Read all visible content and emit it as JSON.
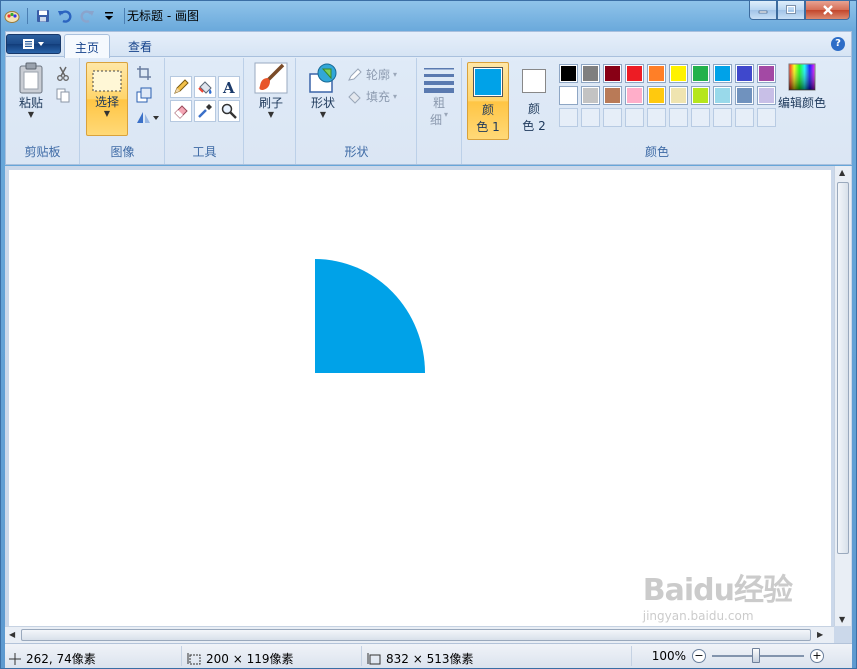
{
  "window": {
    "title": "无标题 - 画图"
  },
  "tabs": {
    "home": "主页",
    "view": "查看"
  },
  "ribbon": {
    "clipboard": {
      "paste_label": "粘贴",
      "group_label": "剪贴板"
    },
    "image": {
      "select_label": "选择",
      "group_label": "图像"
    },
    "tools": {
      "group_label": "工具"
    },
    "brushes": {
      "label": "刷子"
    },
    "shapes": {
      "shapes_label": "形状",
      "outline_label": "轮廓",
      "fill_label": "填充",
      "group_label": "形状"
    },
    "size": {
      "label_line1": "粗",
      "label_line2": "细"
    },
    "colors": {
      "color1_line1": "颜",
      "color1_line2": "色 1",
      "color2_line1": "颜",
      "color2_line2": "色 2",
      "edit_colors_label": "编辑颜色",
      "group_label": "颜色",
      "color1_value": "#00a2e8",
      "color2_value": "#ffffff",
      "palette_row1": [
        "#000000",
        "#7f7f7f",
        "#880015",
        "#ed1c24",
        "#ff7f27",
        "#fff200",
        "#22b14c",
        "#00a2e8",
        "#3f48cc",
        "#a349a4"
      ],
      "palette_row2": [
        "#ffffff",
        "#c3c3c3",
        "#b97a57",
        "#ffaec9",
        "#ffc90e",
        "#efe4b0",
        "#b5e61d",
        "#99d9ea",
        "#7092be",
        "#c8bfe7"
      ]
    }
  },
  "canvas": {
    "shape": "quarter-circle",
    "fill_color": "#00a2e8"
  },
  "status": {
    "cursor_pos": "262, 74像素",
    "selection_size": "200 × 119像素",
    "image_size": "832 × 513像素",
    "zoom": "100%"
  },
  "watermark": {
    "brand": "Baidu经验",
    "url": "jingyan.baidu.com"
  }
}
